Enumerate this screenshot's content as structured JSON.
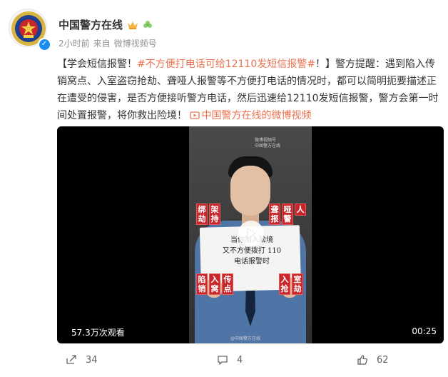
{
  "author": {
    "name": "中国警方在线",
    "time": "2小时前",
    "source_prefix": "来自",
    "source": "微博视频号"
  },
  "post": {
    "part1": "【学会短信报警！",
    "topic": "#不方便打电话可给12110发短信报警#",
    "part2": "！】警方提醒：遇到陷入传销窝点、入室盗窃抢劫、聋哑人报警等不方便打电话的情况时，都可以简明扼要描述正在遭受的侵害，是否方便接听警方电话，然后迅速给12110发短信报警，警方会第一时间处置报警，将你救出险境！",
    "video_link": "中国警方在线的微博视频"
  },
  "video": {
    "views": "57.3万次观看",
    "duration": "00:25",
    "watermark_top": "微博视频号",
    "watermark_top_sub": "中国警方在线",
    "watermark_bottom": "@中国警方在线",
    "sign_lines": [
      "当你陷入险境",
      "又不方便拨打 110",
      "电话报警时"
    ],
    "tags": {
      "t1": [
        "绑",
        "劫"
      ],
      "t2": [
        "架",
        "持"
      ],
      "t3": [
        "聋",
        "报"
      ],
      "t4": [
        "哑",
        "警"
      ],
      "t5": [
        "人"
      ],
      "t6": [
        "陷",
        "销"
      ],
      "t7": [
        "入",
        "窝"
      ],
      "t8": [
        "传",
        "点"
      ],
      "t9": [
        "入",
        "抢"
      ],
      "t10": [
        "室",
        "劫"
      ]
    }
  },
  "actions": {
    "repost_count": "34",
    "comment_count": "4",
    "like_count": "62"
  },
  "colors": {
    "accent": "#eb7350",
    "verified": "#1b8cf2",
    "tag_red": "#c8262b"
  }
}
